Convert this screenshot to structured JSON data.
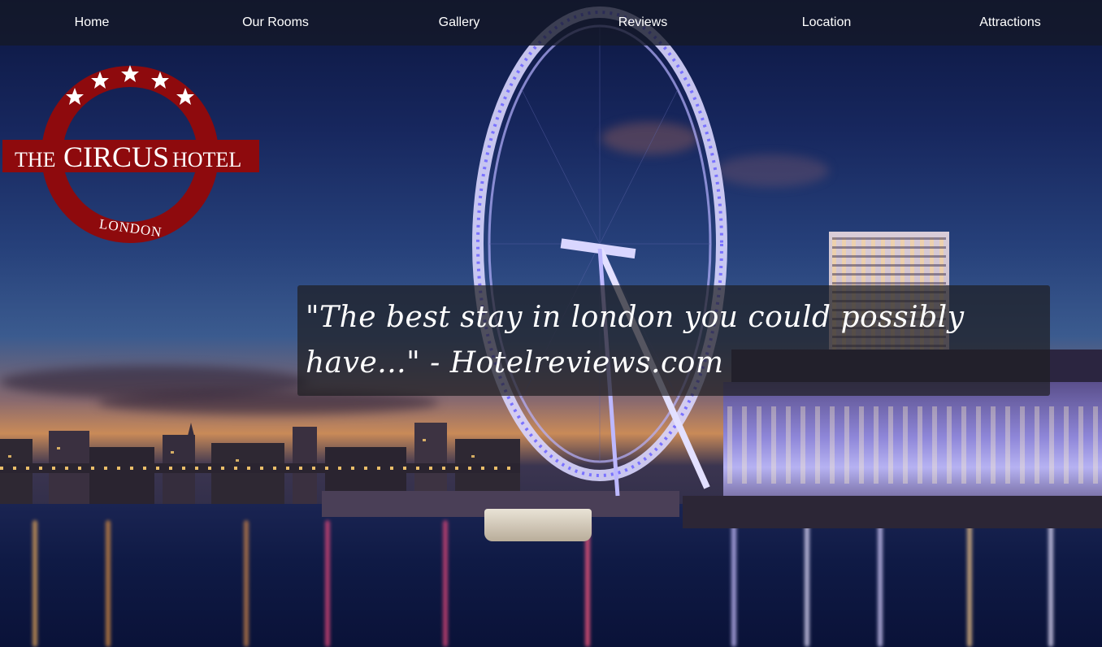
{
  "nav": {
    "items": [
      {
        "label": "Home"
      },
      {
        "label": "Our Rooms"
      },
      {
        "label": "Gallery"
      },
      {
        "label": "Reviews"
      },
      {
        "label": "Location"
      },
      {
        "label": "Attractions"
      }
    ]
  },
  "logo": {
    "brand_the": "THE",
    "brand_circus": "CIRCUS",
    "brand_hotel": "HOTEL",
    "city": "LONDON",
    "stars": 5,
    "ring_color": "#8e0a0d",
    "star_color": "#ffffff"
  },
  "hero": {
    "quote": "\"The best stay in london you could possibly have...\" - Hotelreviews.com"
  },
  "colors": {
    "nav_bg": "#14182699",
    "quote_bg": "#1e1e22",
    "text": "#ffffff"
  }
}
